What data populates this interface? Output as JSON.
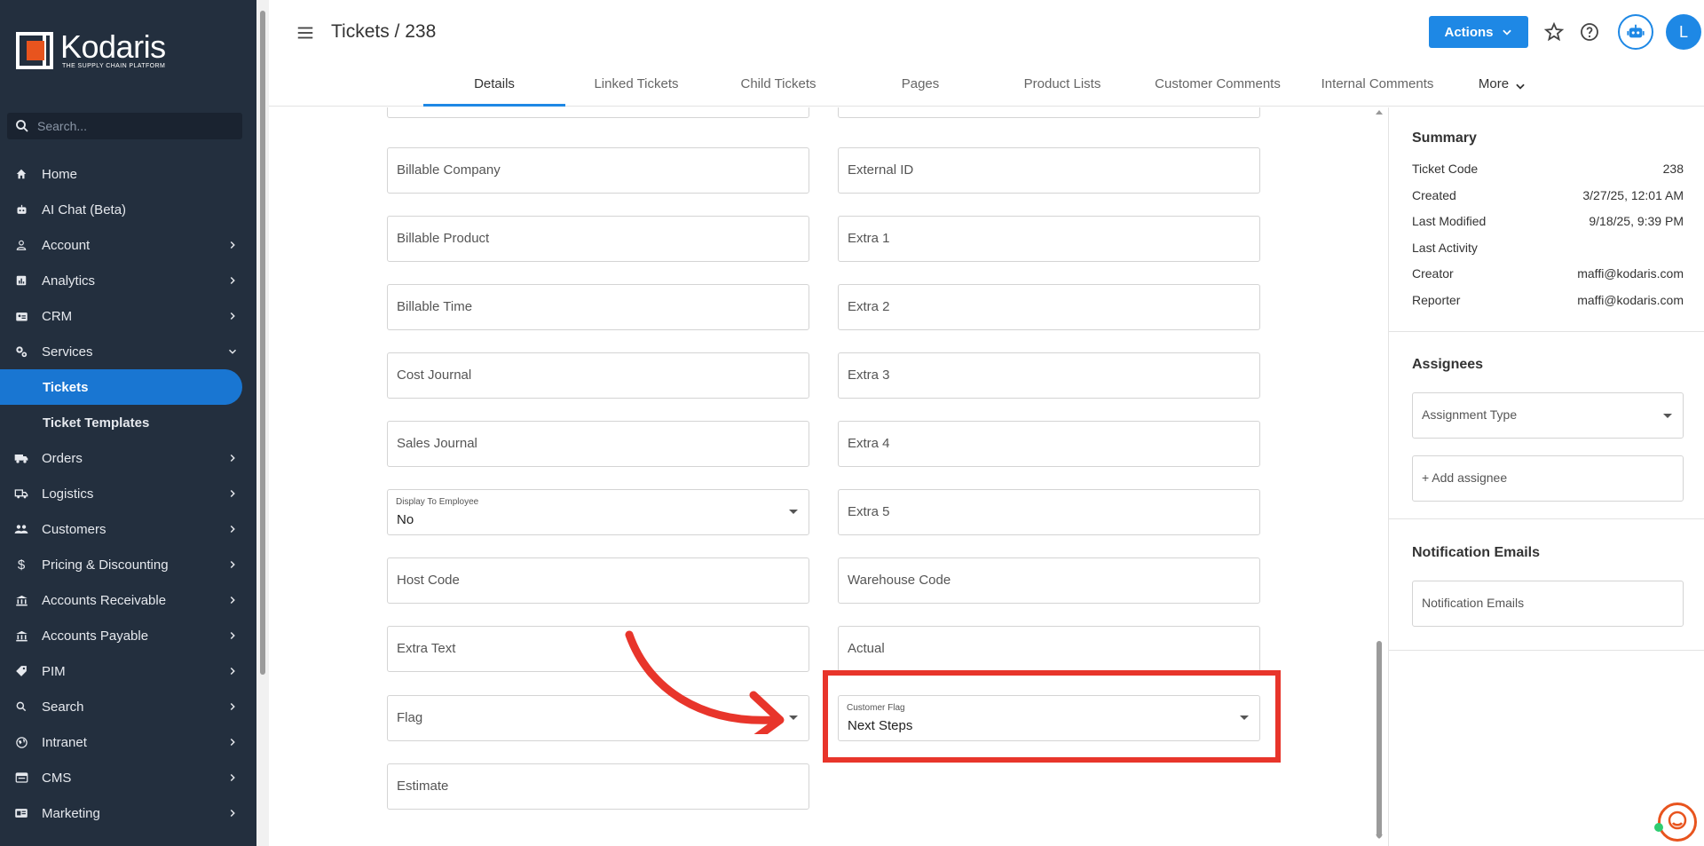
{
  "brand": {
    "name": "Kodaris",
    "tagline": "THE SUPPLY CHAIN PLATFORM",
    "accent": "#1e88e5",
    "sidebar_bg": "#232f3e"
  },
  "sidebar": {
    "search_placeholder": "Search...",
    "items": [
      {
        "label": "Home",
        "icon": "home-icon",
        "chevron": false
      },
      {
        "label": "AI Chat (Beta)",
        "icon": "robot-icon",
        "chevron": false
      },
      {
        "label": "Account",
        "icon": "person-icon",
        "chevron": true
      },
      {
        "label": "Analytics",
        "icon": "analytics-icon",
        "chevron": true
      },
      {
        "label": "CRM",
        "icon": "crm-icon",
        "chevron": true
      },
      {
        "label": "Services",
        "icon": "services-icon",
        "chevron": true,
        "expanded": true
      },
      {
        "label": "Tickets",
        "sub": true,
        "active": true
      },
      {
        "label": "Ticket Templates",
        "sub": true
      },
      {
        "label": "Orders",
        "icon": "truck-icon",
        "chevron": true
      },
      {
        "label": "Logistics",
        "icon": "shipping-icon",
        "chevron": true
      },
      {
        "label": "Customers",
        "icon": "people-icon",
        "chevron": true
      },
      {
        "label": "Pricing & Discounting",
        "icon": "dollar-icon",
        "chevron": true
      },
      {
        "label": "Accounts Receivable",
        "icon": "bank-icon",
        "chevron": true
      },
      {
        "label": "Accounts Payable",
        "icon": "bank-icon",
        "chevron": true
      },
      {
        "label": "PIM",
        "icon": "tag-icon",
        "chevron": true
      },
      {
        "label": "Search",
        "icon": "search-icon",
        "chevron": true
      },
      {
        "label": "Intranet",
        "icon": "globe-icon",
        "chevron": true
      },
      {
        "label": "CMS",
        "icon": "cms-icon",
        "chevron": true
      },
      {
        "label": "Marketing",
        "icon": "marketing-icon",
        "chevron": true
      }
    ]
  },
  "header": {
    "title": "Tickets / 238",
    "actions_label": "Actions",
    "avatar_initial": "L"
  },
  "tabs": [
    {
      "label": "Details",
      "active": true
    },
    {
      "label": "Linked Tickets"
    },
    {
      "label": "Child Tickets"
    },
    {
      "label": "Pages"
    },
    {
      "label": "Product Lists"
    },
    {
      "label": "Customer Comments"
    },
    {
      "label": "Internal Comments"
    },
    {
      "label": "More"
    }
  ],
  "form": {
    "left": [
      {
        "label": "Billable Company"
      },
      {
        "label": "Billable Product"
      },
      {
        "label": "Billable Time"
      },
      {
        "label": "Cost Journal"
      },
      {
        "label": "Sales Journal"
      },
      {
        "label": "Display To Employee",
        "value": "No",
        "select": true
      },
      {
        "label": "Host Code"
      },
      {
        "label": "Extra Text"
      },
      {
        "label": "Flag",
        "select": true
      },
      {
        "label": "Estimate"
      }
    ],
    "right": [
      {
        "label": "External ID"
      },
      {
        "label": "Extra 1"
      },
      {
        "label": "Extra 2"
      },
      {
        "label": "Extra 3"
      },
      {
        "label": "Extra 4"
      },
      {
        "label": "Extra 5"
      },
      {
        "label": "Warehouse Code"
      },
      {
        "label": "Actual"
      },
      {
        "label": "Customer Flag",
        "value": "Next Steps",
        "select": true
      }
    ]
  },
  "summary": {
    "title": "Summary",
    "rows": [
      {
        "label": "Ticket Code",
        "value": "238"
      },
      {
        "label": "Created",
        "value": "3/27/25, 12:01 AM"
      },
      {
        "label": "Last Modified",
        "value": "9/18/25, 9:39 PM"
      },
      {
        "label": "Last Activity",
        "value": ""
      },
      {
        "label": "Creator",
        "value": "maffi@kodaris.com"
      },
      {
        "label": "Reporter",
        "value": "maffi@kodaris.com"
      }
    ]
  },
  "assignees": {
    "title": "Assignees",
    "type_placeholder": "Assignment Type",
    "add_label": "+ Add assignee"
  },
  "notifications": {
    "title": "Notification Emails",
    "placeholder": "Notification Emails"
  },
  "annotation": {
    "color": "#e8352b"
  }
}
